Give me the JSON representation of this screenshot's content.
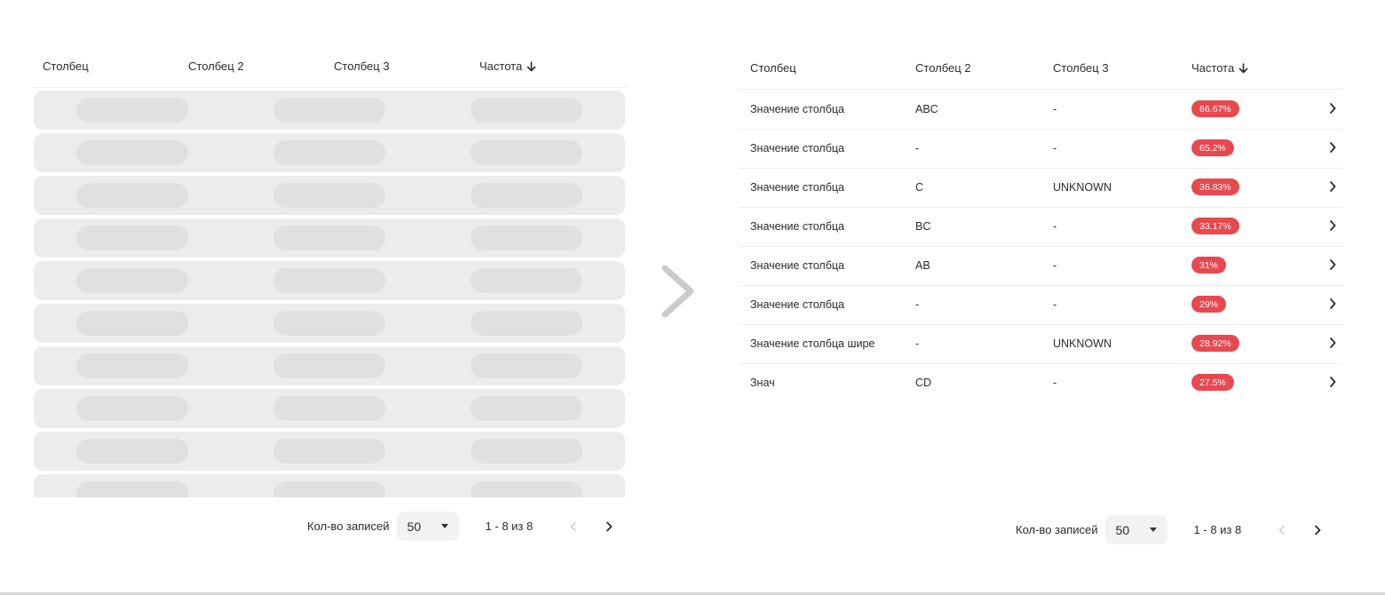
{
  "columns": [
    "Столбец",
    "Столбец 2",
    "Столбец 3",
    "Частота"
  ],
  "icons": {
    "sort": "arrow-down-icon",
    "row_open": "chevron-right-icon",
    "transition": "chevron-right-icon"
  },
  "colors": {
    "badge": "#e8484f",
    "skeleton_row": "#ececec",
    "skeleton_pill": "#e0e0e0",
    "divider": "#ededed"
  },
  "rows": [
    {
      "col1": "Значение столбца",
      "col2": "ABC",
      "col3": "-",
      "freq": "66.67%"
    },
    {
      "col1": "Значение столбца",
      "col2": "-",
      "col3": "-",
      "freq": "65.2%"
    },
    {
      "col1": "Значение столбца",
      "col2": "C",
      "col3": "UNKNOWN",
      "freq": "36.83%"
    },
    {
      "col1": "Значение столбца",
      "col2": "BC",
      "col3": "-",
      "freq": "33.17%"
    },
    {
      "col1": "Значение столбца",
      "col2": "AB",
      "col3": "-",
      "freq": "31%"
    },
    {
      "col1": "Значение столбца",
      "col2": "-",
      "col3": "-",
      "freq": "29%"
    },
    {
      "col1": "Значение столбца шире",
      "col2": "-",
      "col3": "UNKNOWN",
      "freq": "28.92%"
    },
    {
      "col1": "Знач",
      "col2": "CD",
      "col3": "-",
      "freq": "27.5%"
    }
  ],
  "pagination": {
    "records_label": "Кол-во записей",
    "page_size": "50",
    "range_text": "1 - 8 из 8"
  }
}
